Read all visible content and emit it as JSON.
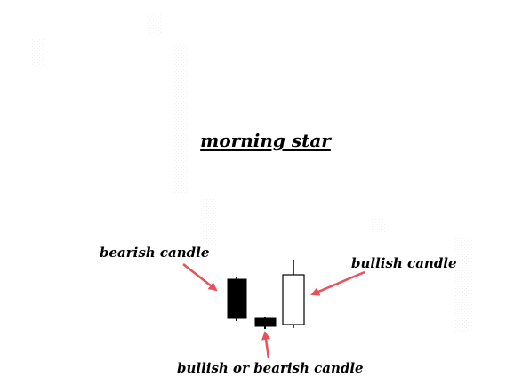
{
  "title": "morning star",
  "labels": {
    "first_candle": "bearish candle",
    "third_candle": "bullish candle",
    "middle_candle": "bullish or bearish candle"
  },
  "colors": {
    "bearish_body": "#000000",
    "bullish_body": "#ffffff",
    "arrow": "#e8505b",
    "text": "#000000"
  }
}
